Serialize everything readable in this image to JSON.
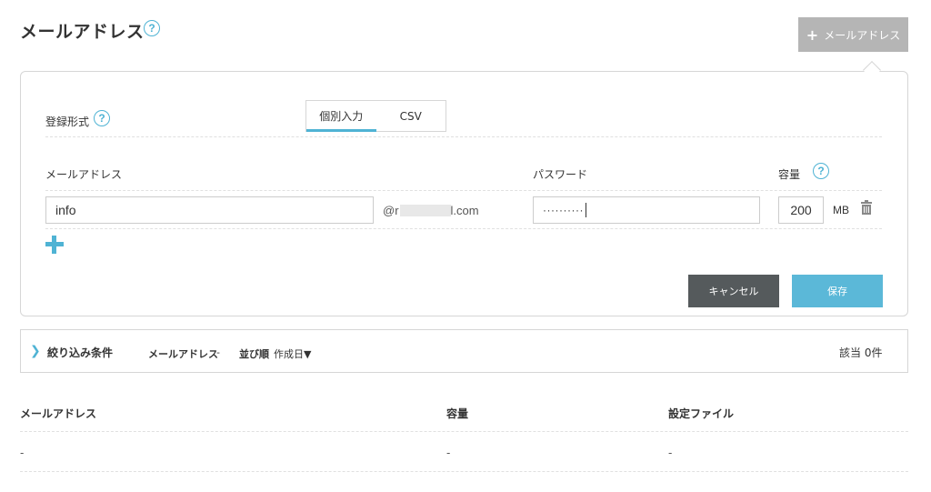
{
  "header": {
    "title": "メールアドレス",
    "help_glyph": "?",
    "add_button_plus": "+",
    "add_button_label": "メールアドレス"
  },
  "form": {
    "registration_label": "登録形式",
    "tabs": [
      {
        "label": "個別入力",
        "active": true
      },
      {
        "label": "CSV",
        "active": false
      }
    ],
    "col_email": "メールアドレス",
    "col_password": "パスワード",
    "col_capacity": "容量",
    "email_value": "info",
    "domain_prefix": "@r",
    "domain_suffix": "l.com",
    "password_masked": "··········",
    "capacity_value": "200",
    "capacity_unit": "MB",
    "cancel_label": "キャンセル",
    "save_label": "保存"
  },
  "filter": {
    "chevron": "❯",
    "title": "絞り込み条件",
    "email_label": "メールアドレス",
    "email_value": "-",
    "sort_label": "並び順",
    "sort_value": "作成日▼",
    "count_text": "該当 0件"
  },
  "table": {
    "headers": [
      "メールアドレス",
      "容量",
      "設定ファイル"
    ],
    "row": [
      "-",
      "-",
      "-"
    ]
  },
  "colors": {
    "accent": "#4fb3d4",
    "save": "#5bb8d8",
    "cancel": "#555a5c",
    "add_button": "#b5b5b5"
  },
  "icons": {
    "help": "question-circle-icon",
    "add": "plus-icon",
    "trash": "trash-icon",
    "chevron": "chevron-right-icon"
  }
}
